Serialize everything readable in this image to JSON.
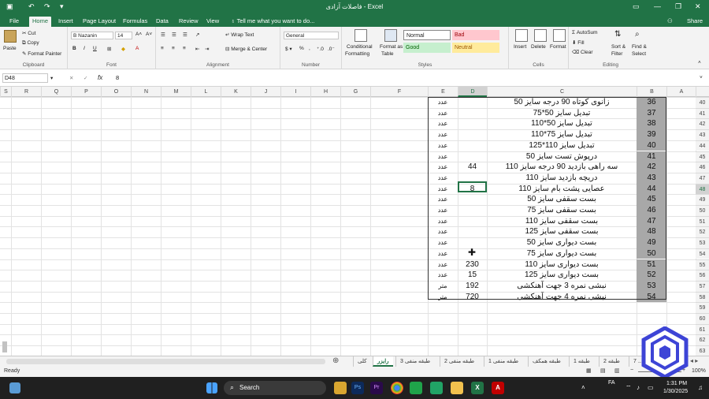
{
  "window": {
    "title": "فاصلات آزادی - Excel",
    "share": "Share"
  },
  "tabs": [
    "File",
    "Home",
    "Insert",
    "Page Layout",
    "Formulas",
    "Data",
    "Review",
    "View",
    "Tell me what you want to do..."
  ],
  "ribbon": {
    "clipboard": {
      "label": "Clipboard",
      "paste": "Paste",
      "cut": "Cut",
      "copy": "Copy",
      "painter": "Format Painter"
    },
    "font": {
      "label": "Font",
      "name": "B Nazanin",
      "size": "14"
    },
    "alignment": {
      "label": "Alignment",
      "wrap": "Wrap Text",
      "merge": "Merge & Center"
    },
    "number": {
      "label": "Number",
      "format": "General"
    },
    "styles": {
      "label": "Styles",
      "cond": "Conditional",
      "cond2": "Formatting",
      "fat": "Format as",
      "fat2": "Table",
      "normal": "Normal",
      "bad": "Bad",
      "good": "Good",
      "neutral": "Neutral"
    },
    "cells": {
      "label": "Cells",
      "insert": "Insert",
      "delete": "Delete",
      "format": "Format"
    },
    "editing": {
      "label": "Editing",
      "autosum": "AutoSum",
      "fill": "Fill",
      "clear": "Clear",
      "sort": "Sort &",
      "sort2": "Filter",
      "find": "Find &",
      "find2": "Select"
    }
  },
  "formula_bar": {
    "name_box": "D48",
    "fx": "fx",
    "formula": "8"
  },
  "columns": [
    "S",
    "R",
    "Q",
    "P",
    "O",
    "N",
    "M",
    "L",
    "K",
    "J",
    "I",
    "H",
    "G",
    "F",
    "E",
    "D",
    "C",
    "B",
    "A"
  ],
  "row_numbers": [
    40,
    41,
    42,
    43,
    44,
    45,
    46,
    47,
    48,
    49,
    50,
    51,
    52,
    53,
    54,
    55,
    56,
    57,
    58,
    59,
    60,
    61,
    62,
    63
  ],
  "rows": [
    {
      "b": "36",
      "c": "زانوی کوتاه 90 درجه سایز 50",
      "d": "",
      "e": "عدد"
    },
    {
      "b": "37",
      "c": "تبدیل سایز 50*75",
      "d": "",
      "e": "عدد"
    },
    {
      "b": "38",
      "c": "تبدیل سایز 50*110",
      "d": "",
      "e": "عدد"
    },
    {
      "b": "39",
      "c": "تبدیل سایز 75*110",
      "d": "",
      "e": "عدد"
    },
    {
      "b": "40",
      "c": "تبدیل سایز 110*125",
      "d": "",
      "e": "عدد"
    },
    {
      "b": "41",
      "c": "درپوش تست سایز 50",
      "d": "",
      "e": "عدد"
    },
    {
      "b": "42",
      "c": "سه راهی بازدید 90 درجه سایز 110",
      "d": "44",
      "e": "عدد"
    },
    {
      "b": "43",
      "c": "دریچه بازدید سایز 110",
      "d": "",
      "e": "عدد"
    },
    {
      "b": "44",
      "c": "عصایی پشت بام سایز 110",
      "d": "8",
      "e": "عدد"
    },
    {
      "b": "45",
      "c": "بست سقفی سایز 50",
      "d": "",
      "e": "عدد"
    },
    {
      "b": "46",
      "c": "بست سقفی سایز 75",
      "d": "",
      "e": "عدد"
    },
    {
      "b": "47",
      "c": "بست سقفی سایز 110",
      "d": "",
      "e": "عدد"
    },
    {
      "b": "48",
      "c": "بست سقفی سایز 125",
      "d": "",
      "e": "عدد"
    },
    {
      "b": "49",
      "c": "بست دیواری سایز 50",
      "d": "",
      "e": "عدد"
    },
    {
      "b": "50",
      "c": "بست دیواری سایز 75",
      "d": "",
      "e": "عدد"
    },
    {
      "b": "51",
      "c": "بست دیواری سایز 110",
      "d": "230",
      "e": "عدد"
    },
    {
      "b": "52",
      "c": "بست دیواری سایز 125",
      "d": "15",
      "e": "عدد"
    },
    {
      "b": "53",
      "c": "نبشی نمره 3 جهت آهنکشی",
      "d": "192",
      "e": "متر"
    },
    {
      "b": "54",
      "c": "نبشی نمره 4 جهت آهنکشی",
      "d": "720",
      "e": "متر"
    }
  ],
  "sheet_tabs": [
    "کلی",
    "رایزر",
    "طبقه منفی 3",
    "طبقه منفی 2",
    "طبقه منفی 1",
    "طبقه همکف",
    "طبقه 1",
    "طبقه 2",
    "7 ..."
  ],
  "status": {
    "ready": "Ready",
    "zoom": "100%"
  },
  "taskbar": {
    "search": "Search",
    "time": "1:31 PM",
    "date": "1/30/2025",
    "lang": "FA"
  },
  "colors": {
    "excel_green": "#217346",
    "row_number_fill": "#a8a8a8"
  }
}
